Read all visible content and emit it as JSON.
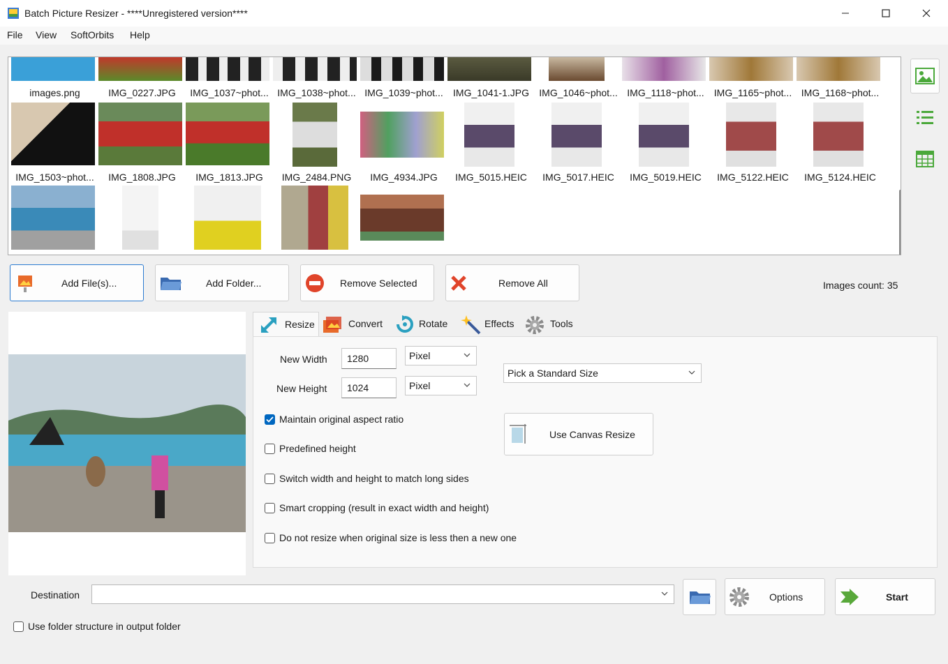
{
  "window": {
    "title": "Batch Picture Resizer - ****Unregistered version****",
    "minimize_icon": "minimize-icon",
    "maximize_icon": "maximize-icon",
    "close_icon": "close-icon"
  },
  "menu": {
    "items": [
      "File",
      "View",
      "SoftOrbits",
      "Help"
    ]
  },
  "thumbnails": {
    "row1": [
      "images.png",
      "IMG_0227.JPG",
      "IMG_1037~phot...",
      "IMG_1038~phot...",
      "IMG_1039~phot...",
      "IMG_1041-1.JPG",
      "IMG_1046~phot...",
      "IMG_1118~phot...",
      "IMG_1165~phot...",
      "IMG_1168~phot..."
    ],
    "row2": [
      "IMG_1503~phot...",
      "IMG_1808.JPG",
      "IMG_1813.JPG",
      "IMG_2484.PNG",
      "IMG_4934.JPG",
      "IMG_5015.HEIC",
      "IMG_5017.HEIC",
      "IMG_5019.HEIC",
      "IMG_5122.HEIC",
      "IMG_5124.HEIC"
    ]
  },
  "view_buttons": {
    "thumbnails_icon": "picture-icon",
    "list_icon": "list-icon",
    "table_icon": "table-icon"
  },
  "file_buttons": {
    "add_files": "Add File(s)...",
    "add_folder": "Add Folder...",
    "remove_selected": "Remove Selected",
    "remove_all": "Remove All"
  },
  "images_count": "Images count: 35",
  "tabs": {
    "resize": "Resize",
    "convert": "Convert",
    "rotate": "Rotate",
    "effects": "Effects",
    "tools": "Tools"
  },
  "resize": {
    "new_width_label": "New Width",
    "new_width_value": "1280",
    "width_unit": "Pixel",
    "new_height_label": "New Height",
    "new_height_value": "1024",
    "height_unit": "Pixel",
    "standard_size": "Pick a Standard Size",
    "canvas_resize": "Use Canvas Resize",
    "maintain_aspect": "Maintain original aspect ratio",
    "predefined_height": "Predefined height",
    "switch_sides": "Switch width and height to match long sides",
    "smart_cropping": "Smart cropping (result in exact width and height)",
    "no_upscale": "Do not resize when original size is less then a new one"
  },
  "bottom": {
    "destination_label": "Destination",
    "destination_value": "",
    "options": "Options",
    "start": "Start",
    "folder_structure": "Use folder structure in output folder"
  },
  "colors": {
    "accent": "#0067c0",
    "panel_bg": "#f0f0f0",
    "remove_red": "#e0442a",
    "start_green": "#58a83a"
  }
}
